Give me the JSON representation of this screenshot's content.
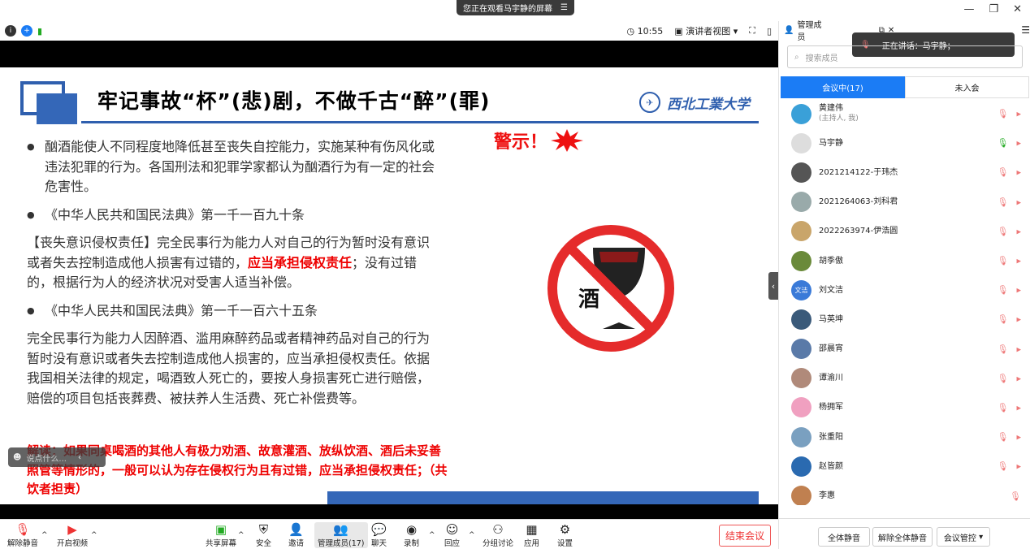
{
  "banner": {
    "text": "您正在观看马宇静的屏幕",
    "icon": "menu-icon"
  },
  "toolbar": {
    "time": "10:55",
    "view_mode": "演讲者视图"
  },
  "slide": {
    "title": "牢记事故“杯”(悲)剧，不做千古“醉”(罪)",
    "university": "西北工業大学",
    "warning": "警示！",
    "sign_char": "酒",
    "para1": "酗酒能使人不同程度地降低甚至丧失自控能力，实施某种有伤风化或违法犯罪的行为。各国刑法和犯罪学家都认为酗酒行为有一定的社会危害性。",
    "bullet2": "《中华人民共和国民法典》第一千一百九十条",
    "para3_a": "【丧失意识侵权责任】完全民事行为能力人对自己的行为暂时没有意识或者失去控制造成他人损害有过错的，",
    "para3_red": "应当承担侵权责任",
    "para3_b": "；没有过错的，根据行为人的经济状况对受害人适当补偿。",
    "bullet4": "《中华人民共和国民法典》第一千一百六十五条",
    "para5": "完全民事行为能力人因醉酒、滥用麻醉药品或者精神药品对自己的行为暂时没有意识或者失去控制造成他人损害的，应当承担侵权责任。依据我国相关法律的规定，喝酒致人死亡的，要按人身损害死亡进行赔偿，赔偿的项目包括丧葬费、被扶养人生活费、死亡补偿费等。",
    "red_block": "解读：如果同桌喝酒的其他人有极力劝酒、故意灌酒、放纵饮酒、酒后未妥善照管等情形的，一般可以认为存在侵权行为且有过错，应当承担侵权责任；（共饮者担责）"
  },
  "comment_placeholder": "说点什么...",
  "bottom": {
    "unmute": "解除静音",
    "video": "开启视频",
    "share": "共享屏幕",
    "security": "安全",
    "invite": "邀请",
    "members": "管理成员(17)",
    "chat": "聊天",
    "record": "录制",
    "reactions": "回应",
    "breakout": "分组讨论",
    "apps": "应用",
    "settings": "设置",
    "end": "结束会议"
  },
  "panel": {
    "title": "管理成员",
    "speaking": "正在讲话：马宇静；",
    "search_placeholder": "搜索成员",
    "tab_in": "会议中(17)",
    "tab_out": "未入会",
    "members": [
      {
        "name": "黄建伟",
        "sub": "(主持人, 我)",
        "color": "#3aa0d8"
      },
      {
        "name": "马宇静",
        "sub": "",
        "color": "#ddd"
      },
      {
        "name": "2021214122-于玮杰",
        "sub": "",
        "color": "#555"
      },
      {
        "name": "2021264063-刘科君",
        "sub": "",
        "color": "#9aa"
      },
      {
        "name": "2022263974-伊浩圆",
        "sub": "",
        "color": "#c9a56a"
      },
      {
        "name": "胡季傲",
        "sub": "",
        "color": "#6a8a3a"
      },
      {
        "name": "刘文洁",
        "sub": "",
        "color": "#3a7ad8",
        "initials": "文洁"
      },
      {
        "name": "马英坤",
        "sub": "",
        "color": "#3a5a7a"
      },
      {
        "name": "邵晨宵",
        "sub": "",
        "color": "#5a7aa8"
      },
      {
        "name": "谭渝川",
        "sub": "",
        "color": "#b08a7a"
      },
      {
        "name": "杨拥军",
        "sub": "",
        "color": "#f0a0c0"
      },
      {
        "name": "张重阳",
        "sub": "",
        "color": "#7aa0c0"
      },
      {
        "name": "赵皆颜",
        "sub": "",
        "color": "#2a6ab0"
      },
      {
        "name": "李惠",
        "sub": "",
        "color": "#c08050"
      }
    ],
    "mute_all": "全体静音",
    "unmute_all": "解除全体静音",
    "control": "会议管控"
  }
}
